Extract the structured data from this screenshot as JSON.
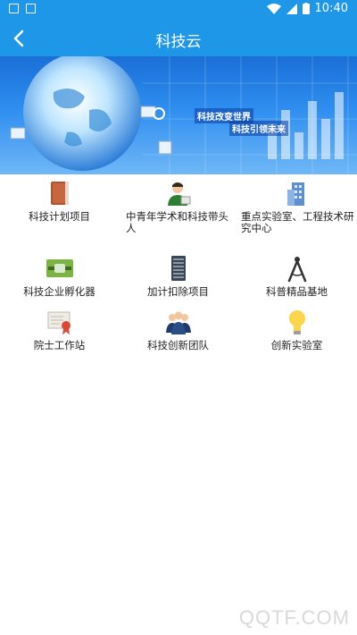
{
  "status_bar": {
    "time": "10:40"
  },
  "header": {
    "title": "科技云"
  },
  "banner": {
    "line1": "科技改变世界",
    "line2": "科技引领未来"
  },
  "grid": [
    {
      "label": "科技计划项目",
      "icon": "book-icon"
    },
    {
      "label": "中青年学术和科技带头人",
      "icon": "person-icon"
    },
    {
      "label": "重点实验室、工程技术研究中心",
      "icon": "building-icon"
    },
    {
      "label": "科技企业孵化器",
      "icon": "plug-icon"
    },
    {
      "label": "加计扣除项目",
      "icon": "server-icon"
    },
    {
      "label": "科普精品基地",
      "icon": "compass-icon"
    },
    {
      "label": "院士工作站",
      "icon": "certificate-icon"
    },
    {
      "label": "科技创新团队",
      "icon": "team-icon"
    },
    {
      "label": "创新实验室",
      "icon": "lightbulb-icon"
    }
  ],
  "watermark": "QQTF.COM",
  "colors": {
    "primary": "#1e97e8",
    "banner": "#2f8ef0"
  }
}
